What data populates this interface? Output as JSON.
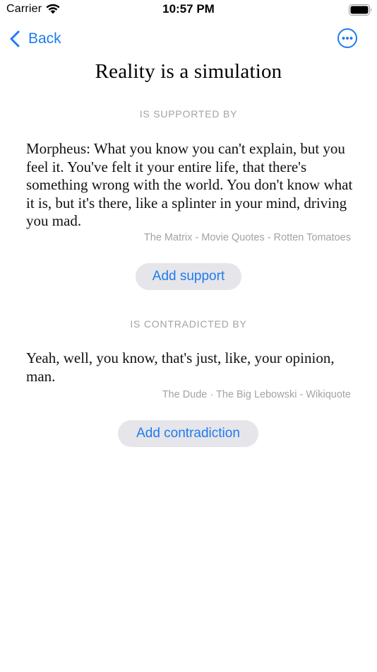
{
  "status_bar": {
    "carrier": "Carrier",
    "time": "10:57 PM"
  },
  "nav": {
    "back_label": "Back",
    "back_icon": "chevron-left-icon",
    "more_icon": "ellipsis-circle-icon"
  },
  "title": "Reality is a simulation",
  "supported": {
    "header": "IS SUPPORTED BY",
    "quote": "Morpheus: What you know you can't explain, but you feel it. You've felt it your entire life, that there's something wrong with the world. You don't know what it is, but it's there, like a splinter in your mind, driving you mad.",
    "source": "The Matrix - Movie Quotes - Rotten Tomatoes",
    "button_label": "Add support"
  },
  "contradicted": {
    "header": "IS CONTRADICTED BY",
    "quote": "Yeah, well, you know, that's just, like, your opinion, man.",
    "source": "The Dude · The Big Lebowski - Wikiquote",
    "button_label": "Add contradiction"
  },
  "colors": {
    "accent": "#1e7cf0",
    "secondary_text": "#a3a3a7",
    "button_bg": "#e5e5ea"
  }
}
